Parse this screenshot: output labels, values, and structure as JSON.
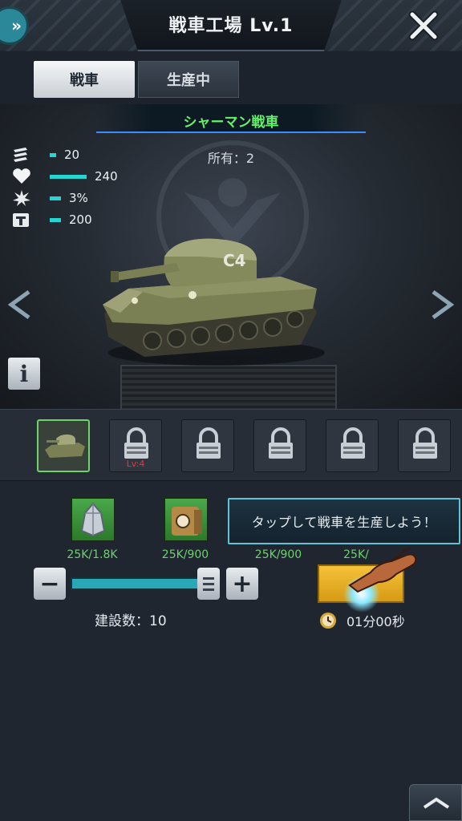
{
  "header": {
    "title": "戦車工場 Lv.1",
    "expand_label": "»",
    "close_icon": "close-icon"
  },
  "tabs": [
    {
      "label": "戦車",
      "active": true
    },
    {
      "label": "生産中",
      "active": false
    }
  ],
  "tank": {
    "name": "シャーマン戦車",
    "owned": "所有：2",
    "decal": "C4",
    "stats": [
      {
        "icon": "ammo-icon",
        "value": "20",
        "fill": 0.05
      },
      {
        "icon": "heart-icon",
        "value": "240",
        "fill": 0.6
      },
      {
        "icon": "explosion-icon",
        "value": "3%",
        "fill": 0.05
      },
      {
        "icon": "cargo-icon",
        "value": "200",
        "fill": 0.05
      }
    ]
  },
  "info_label": "i",
  "slots": [
    {
      "state": "selected",
      "level": ""
    },
    {
      "state": "locked",
      "level": "Lv:4"
    },
    {
      "state": "locked",
      "level": ""
    },
    {
      "state": "locked",
      "level": ""
    },
    {
      "state": "locked",
      "level": ""
    },
    {
      "state": "locked",
      "level": ""
    }
  ],
  "resources": [
    {
      "icon": "crystal-icon",
      "label": "25K/1.8K"
    },
    {
      "icon": "oil-barrel-icon",
      "label": "25K/900"
    },
    {
      "icon": "",
      "label": "25K/900"
    },
    {
      "icon": "",
      "label": "25K/"
    }
  ],
  "tooltip": "タップして戦車を生産しよう！",
  "slider": {
    "minus": "−",
    "plus": "+",
    "level": 1.0
  },
  "build_count": "建設数：10",
  "timer": "01分00秒",
  "colors": {
    "accent": "#27d4d0",
    "name_green": "#63f26a",
    "resource_green": "#6cd36a",
    "gold": "#f5c23a"
  }
}
